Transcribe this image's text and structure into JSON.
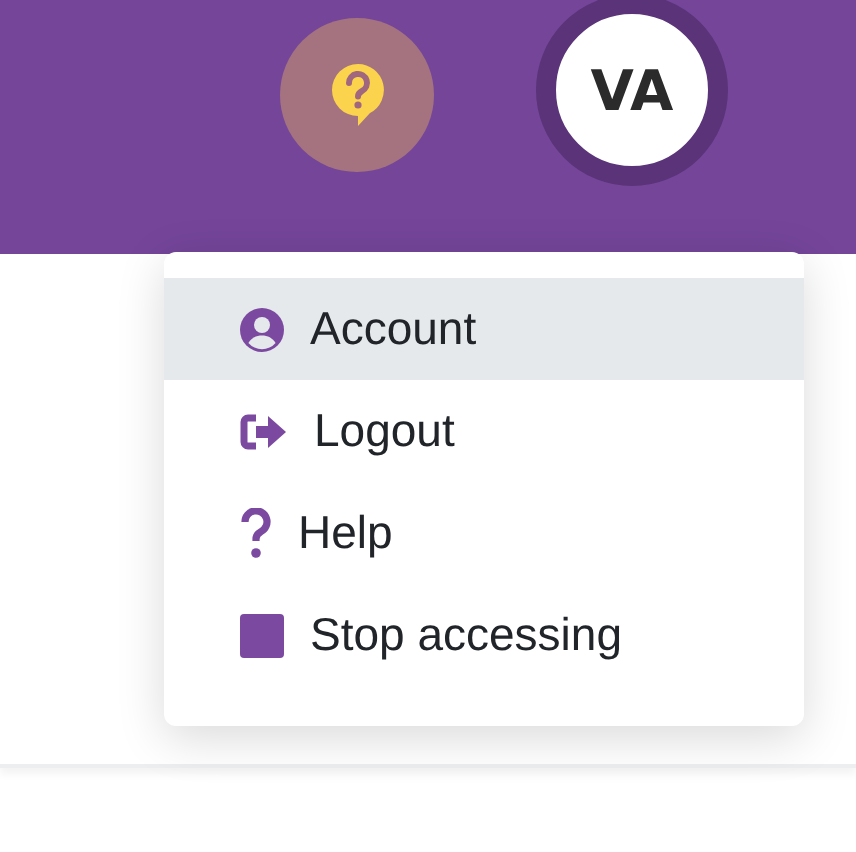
{
  "header": {
    "avatar_initials": "VA"
  },
  "menu": {
    "items": [
      {
        "label": "Account",
        "kind": "account",
        "selected": true
      },
      {
        "label": "Logout",
        "kind": "logout",
        "selected": false
      },
      {
        "label": "Help",
        "kind": "help",
        "selected": false
      },
      {
        "label": "Stop accessing",
        "kind": "stop",
        "selected": false
      }
    ]
  }
}
